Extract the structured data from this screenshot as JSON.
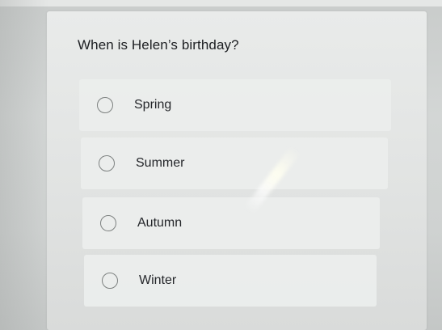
{
  "quiz": {
    "question": "When is Helen’s birthday?",
    "options": [
      {
        "label": "Spring",
        "selected": false
      },
      {
        "label": "Summer",
        "selected": false
      },
      {
        "label": "Autumn",
        "selected": false
      },
      {
        "label": "Winter",
        "selected": false
      }
    ]
  },
  "icons": {
    "radio": "radio-unchecked-icon"
  }
}
